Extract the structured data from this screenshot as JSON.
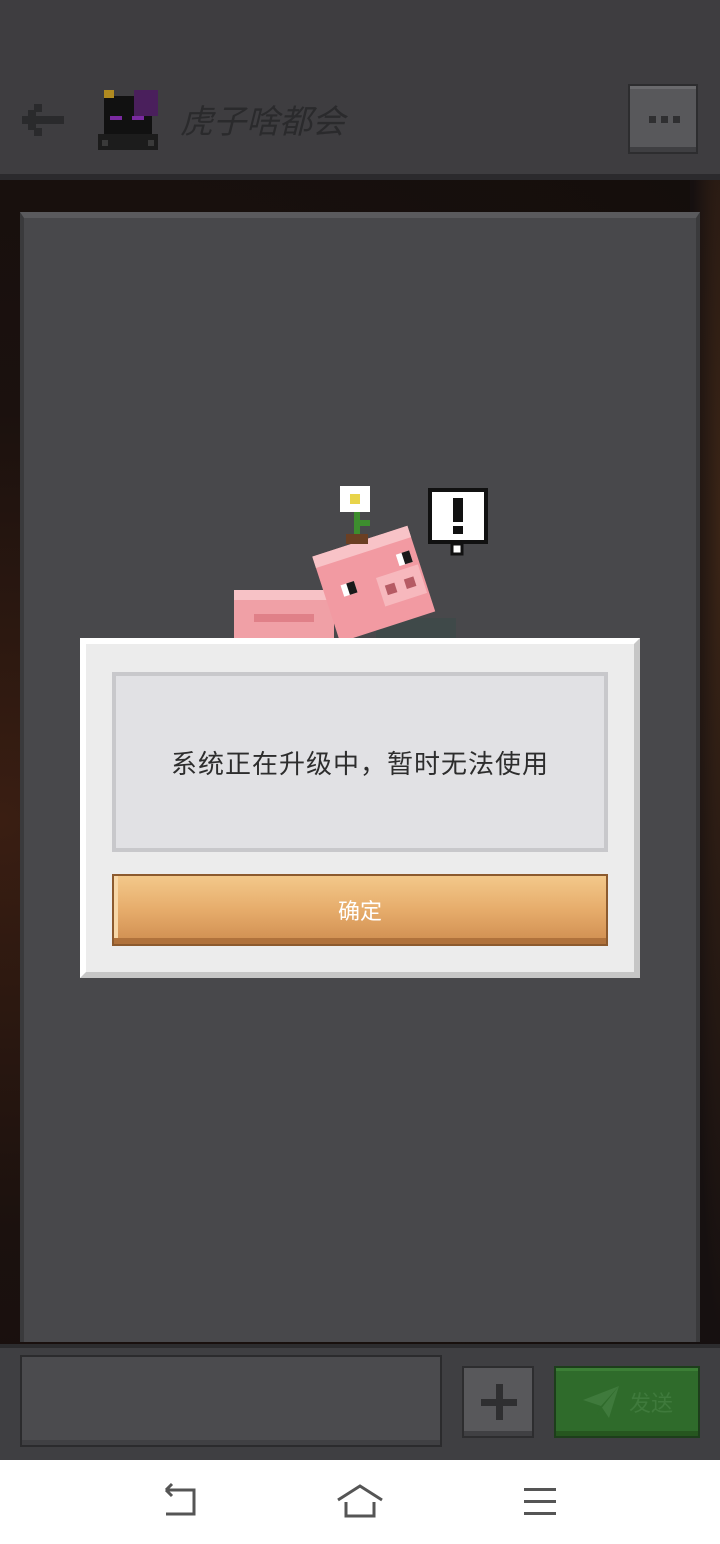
{
  "header": {
    "title": "虎子啥都会",
    "back_icon": "arrow-left-icon",
    "avatar_icon": "enderman-avatar-icon",
    "more_icon": "more-dots-icon"
  },
  "dialog": {
    "message": "系统正在升级中，暂时无法使用",
    "confirm_label": "确定"
  },
  "composer": {
    "input_value": "",
    "plus_icon": "plus-icon",
    "send_icon": "paper-plane-icon",
    "send_label": "发送"
  },
  "system_nav": {
    "back_icon": "nav-back-icon",
    "home_icon": "nav-home-icon",
    "menu_icon": "nav-menu-icon"
  },
  "colors": {
    "confirm_button": "#e6ac6b",
    "send_button": "#2f6b2b",
    "panel": "#48484b"
  }
}
